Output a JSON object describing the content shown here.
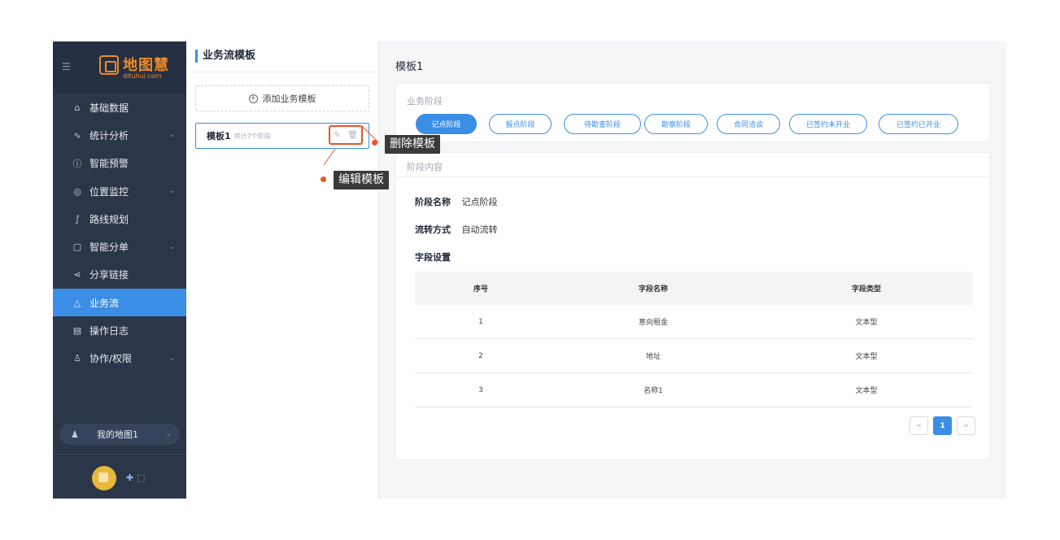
{
  "sidebar": {
    "logo_text": "地图慧",
    "logo_sub": "dituhui.com",
    "items": [
      {
        "label": "基础数据",
        "icon": "home-icon",
        "expandable": false
      },
      {
        "label": "统计分析",
        "icon": "chart-icon",
        "expandable": true
      },
      {
        "label": "智能预警",
        "icon": "info-icon",
        "expandable": false
      },
      {
        "label": "位置监控",
        "icon": "location-icon",
        "expandable": true
      },
      {
        "label": "路线规划",
        "icon": "route-icon",
        "expandable": false
      },
      {
        "label": "智能分单",
        "icon": "copy-icon",
        "expandable": true
      },
      {
        "label": "分享链接",
        "icon": "share-icon",
        "expandable": false
      },
      {
        "label": "业务流",
        "icon": "workflow-icon",
        "expandable": false,
        "active": true
      },
      {
        "label": "操作日志",
        "icon": "clipboard-icon",
        "expandable": false
      },
      {
        "label": "协作/权限",
        "icon": "users-icon",
        "expandable": true
      }
    ],
    "map_select": "我的地图1",
    "user_extra": "✚ ⬚"
  },
  "templates_panel": {
    "title": "业务流模板",
    "add_button": "添加业务模板",
    "items": [
      {
        "name": "模板1",
        "count": "共计7个阶段"
      }
    ]
  },
  "main": {
    "title": "模板1",
    "stages_label": "业务阶段",
    "stages": [
      "记点阶段",
      "报点阶段",
      "待勘查阶段",
      "勘察阶段",
      "合同洽谈",
      "已签约未开业",
      "已签约已开业"
    ],
    "stage_content_label": "阶段内容",
    "stage_name_key": "阶段名称",
    "stage_name_value": "记点阶段",
    "flow_key": "流转方式",
    "flow_value": "自动流转",
    "fields_key": "字段设置",
    "table": {
      "headers": [
        "序号",
        "字段名称",
        "字段类型"
      ],
      "rows": [
        [
          "1",
          "意向租金",
          "文本型"
        ],
        [
          "2",
          "地址",
          "文本型"
        ],
        [
          "3",
          "名称1",
          "文本型"
        ]
      ]
    },
    "pagination": {
      "prev": "<",
      "current": "1",
      "next": ">"
    }
  },
  "annotations": {
    "delete_label": "删除模板",
    "edit_label": "编辑模板"
  },
  "colors": {
    "accent": "#3a8ee6",
    "sidebar_bg": "#2b3648",
    "annotation": "#e5572f",
    "logo": "#f08a24"
  }
}
